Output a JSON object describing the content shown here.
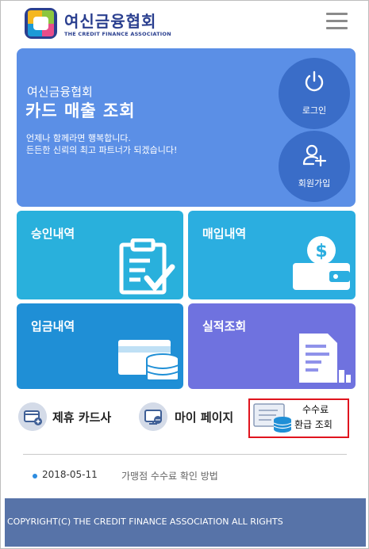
{
  "header": {
    "title": "여신금융협회",
    "subtitle": "THE CREDIT FINANCE ASSOCIATION"
  },
  "hero": {
    "org": "여신금융협회",
    "title": "카드 매출 조회",
    "desc_line1": "언제나 함께라면 행복합니다.",
    "desc_line2": "든든한 신뢰의 최고 파트너가 되겠습니다!",
    "login_label": "로그인",
    "signup_label": "회원가입"
  },
  "tiles": {
    "approval": "승인내역",
    "purchase": "매입내역",
    "deposit": "입금내역",
    "performance": "실적조회"
  },
  "quick_links": {
    "partner_cards": "제휴 카드사",
    "my_page": "마이 페이지",
    "refund_line1": "수수료",
    "refund_line2": "환급 조회"
  },
  "notice": {
    "date": "2018-05-11",
    "title": "가맹점 수수료 확인 방법"
  },
  "footer": {
    "copyright": "COPYRIGHT(C) THE CREDIT FINANCE ASSOCIATION ALL RIGHTS"
  },
  "colors": {
    "hero_bg": "#5b8fe6",
    "circle_btn": "#3a6dc8",
    "tile_approval": "#29b0dc",
    "tile_purchase": "#2baee0",
    "tile_deposit": "#1f8fd6",
    "tile_performance": "#6f72df",
    "highlight_border": "#e0141e",
    "footer_bg": "#5773a8"
  }
}
